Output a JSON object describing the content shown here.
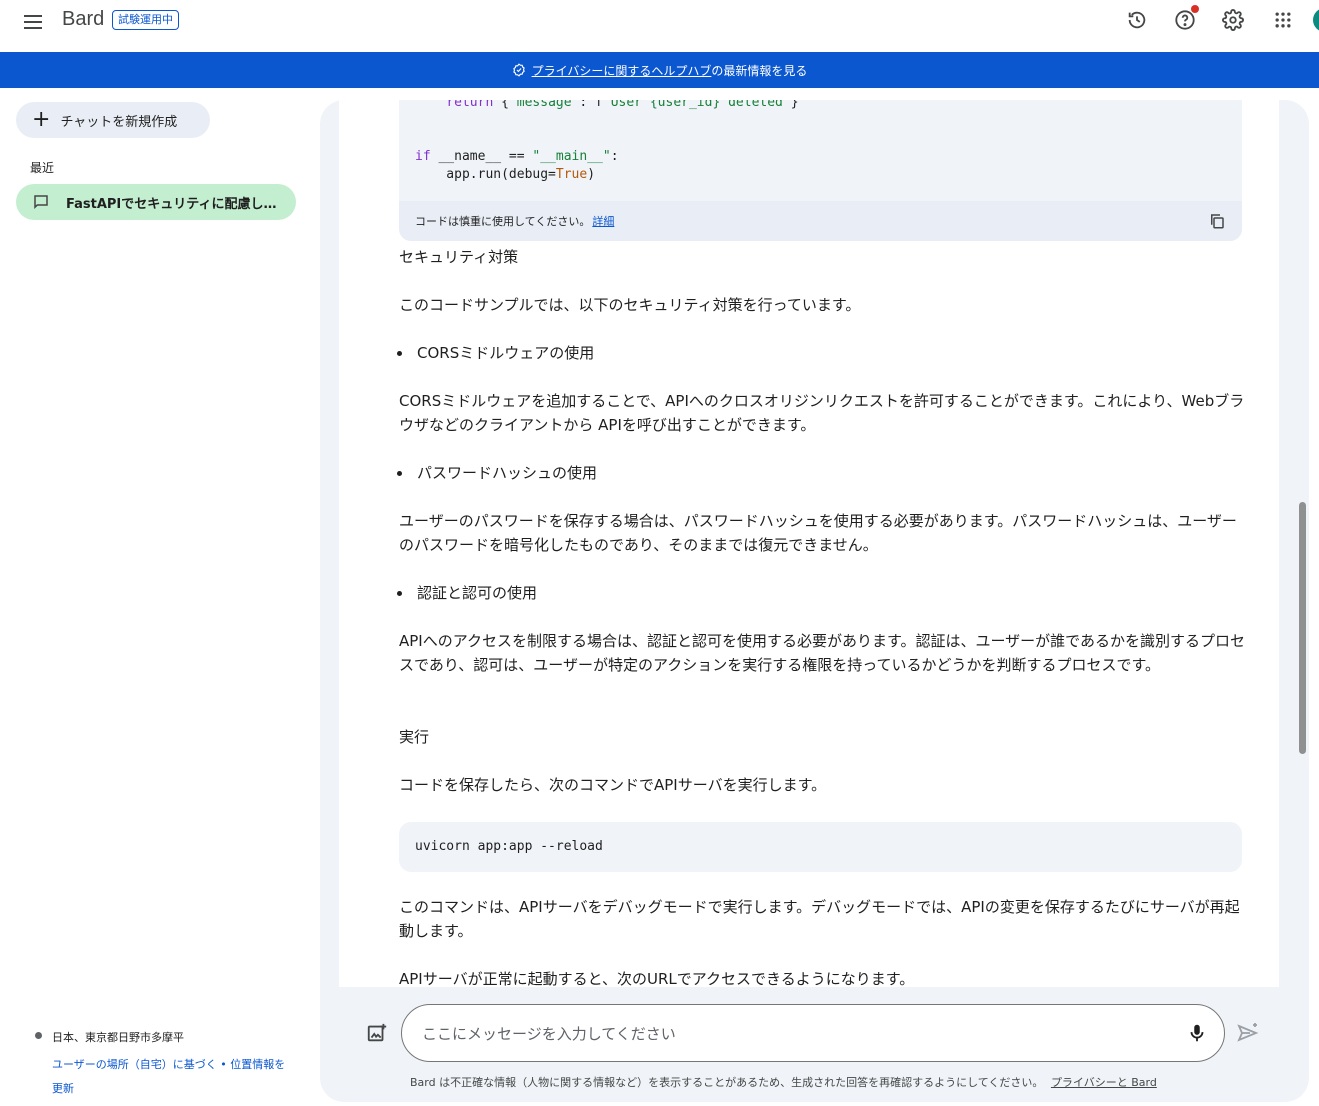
{
  "header": {
    "brand": "Bard",
    "badge": "試験運用中"
  },
  "banner": {
    "link": "プライバシーに関するヘルプハブ",
    "tail": "の最新情報を見る"
  },
  "sidebar": {
    "new_chat": "チャットを新規作成",
    "recent_label": "最近",
    "recent_items": [
      {
        "label": "FastAPIでセキュリティに配慮したAPI"
      }
    ],
    "location": "日本、東京都日野市多摩平",
    "location_link": "ユーザーの場所（自宅）に基づく • 位置情報を更新"
  },
  "conversation": {
    "code_top_footer": "コードは慎重に使用してください。",
    "code_top_footer_link": "詳細",
    "section_security": "セキュリティ対策",
    "intro": "このコードサンプルでは、以下のセキュリティ対策を行っています。",
    "bullet1": "CORSミドルウェアの使用",
    "para1": "CORSミドルウェアを追加することで、APIへのクロスオリジンリクエストを許可することができます。これにより、Webブラウザなどのクライアントから APIを呼び出すことができます。",
    "bullet2": "パスワードハッシュの使用",
    "para2": "ユーザーのパスワードを保存する場合は、パスワードハッシュを使用する必要があります。パスワードハッシュは、ユーザーのパスワードを暗号化したものであり、そのままでは復元できません。",
    "bullet3": "認証と認可の使用",
    "para3": "APIへのアクセスを制限する場合は、認証と認可を使用する必要があります。認証は、ユーザーが誰であるかを識別するプロセスであり、認可は、ユーザーが特定のアクションを実行する権限を持っているかどうかを判断するプロセスです。",
    "section_run": "実行",
    "run_intro": "コードを保存したら、次のコマンドでAPIサーバを実行します。",
    "run_command": "uvicorn app:app --reload",
    "para4": "このコマンドは、APIサーバをデバッグモードで実行します。デバッグモードでは、APIの変更を保存するたびにサーバが再起動します。",
    "para5": "APIサーバが正常に起動すると、次のURLでアクセスできるようになります。"
  },
  "input": {
    "placeholder": "ここにメッセージを入力してください"
  },
  "footer": {
    "disclaimer": "Bard は不正確な情報（人物に関する情報など）を表示することがあるため、生成された回答を再確認するようにしてください。",
    "privacy_link": "プライバシーと Bard"
  }
}
